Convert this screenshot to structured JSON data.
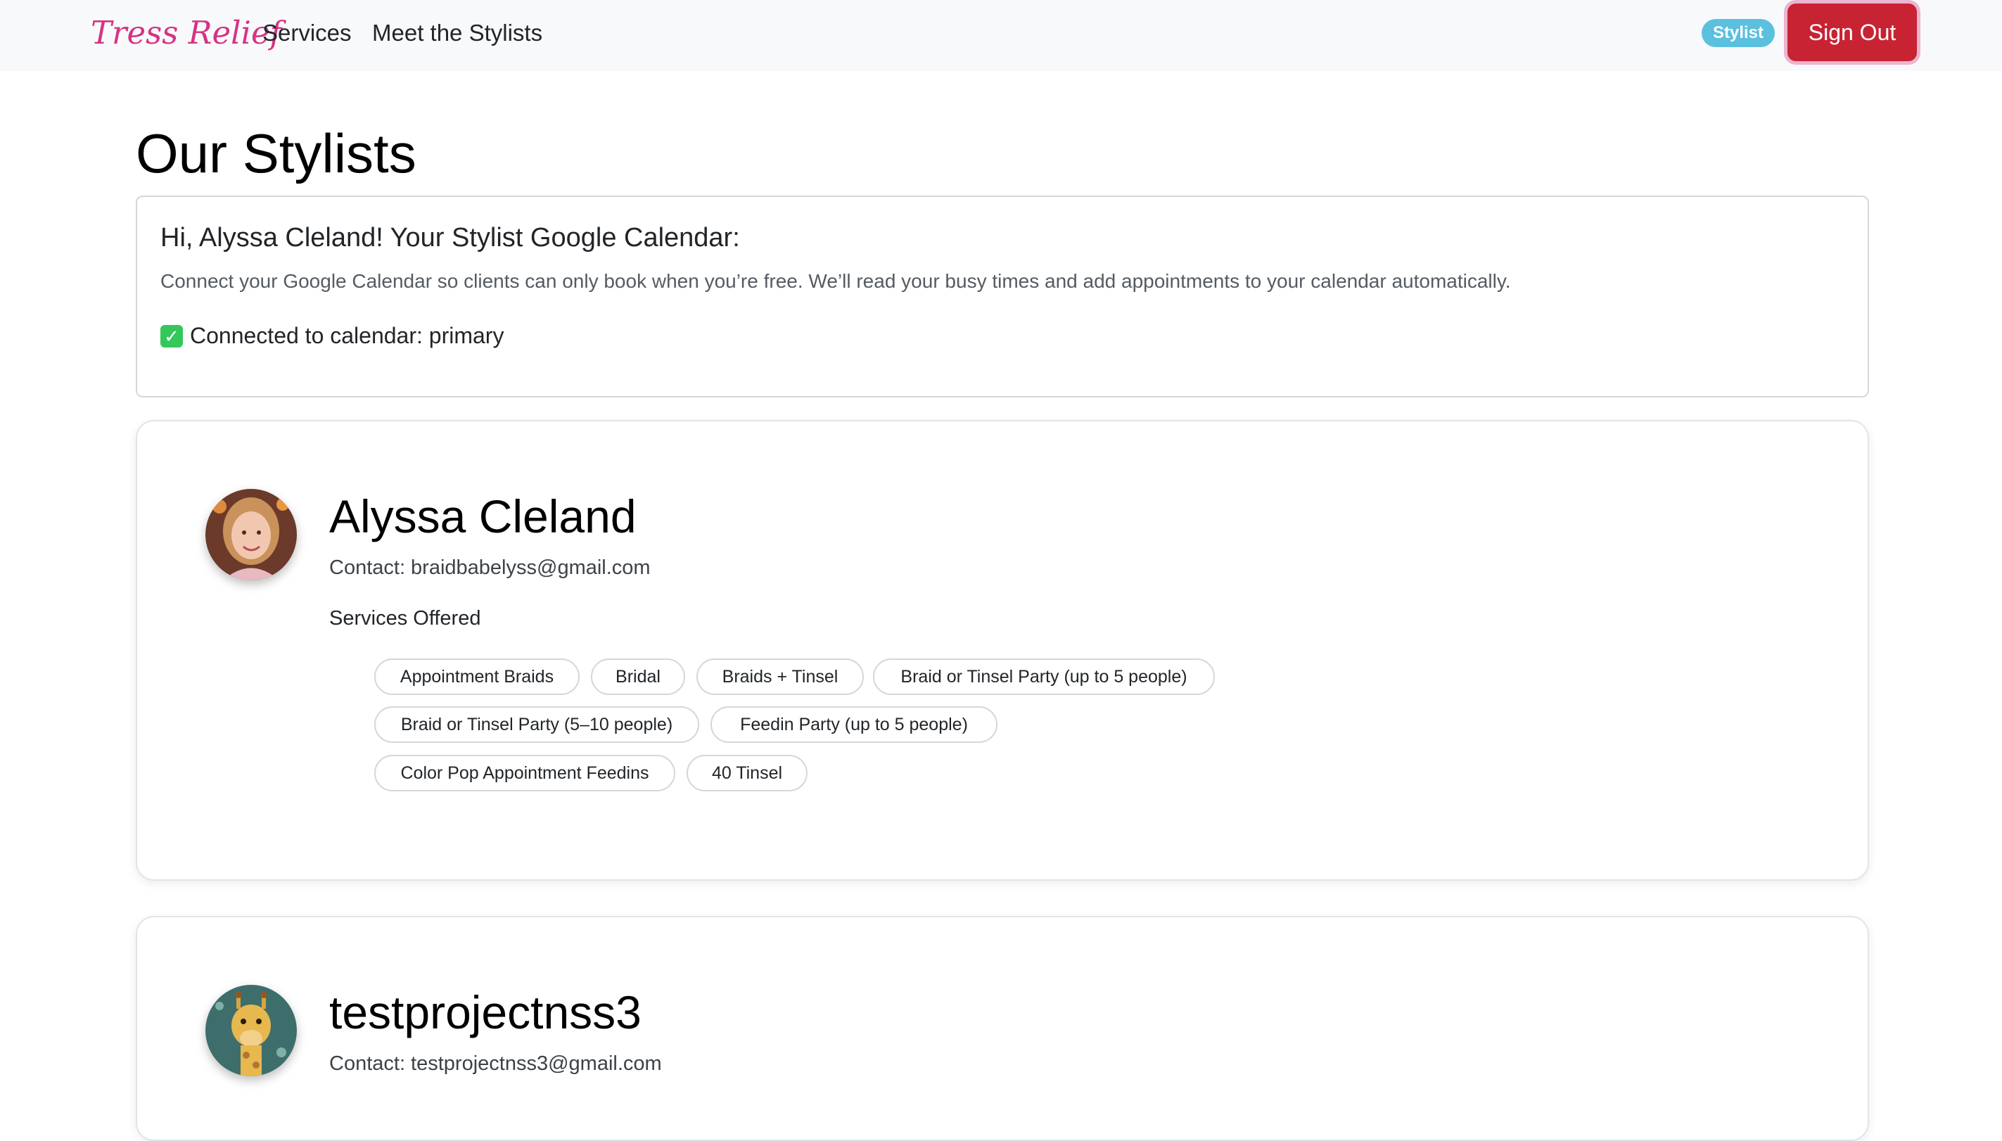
{
  "nav": {
    "brand": "Tress Relief",
    "links": [
      "Services",
      "Meet the Stylists"
    ],
    "role_badge": "Stylist",
    "sign_out": "Sign Out"
  },
  "page": {
    "title": "Our Stylists"
  },
  "calendar_card": {
    "heading": "Hi, Alyssa Cleland! Your Stylist Google Calendar:",
    "description": "Connect your Google Calendar so clients can only book when you’re free. We’ll read your busy times and add appointments to your calendar automatically.",
    "status_icon": "check-mark-icon",
    "status": "Connected to calendar: primary"
  },
  "stylists": [
    {
      "name": "Alyssa Cleland",
      "contact": "Contact: braidbabelyss@gmail.com",
      "services_heading": "Services Offered",
      "services": [
        "Appointment Braids",
        "Bridal",
        "Braids + Tinsel",
        "Braid or Tinsel Party (up to 5 people)",
        "Braid or Tinsel Party (5–10 people)",
        "Feedin Party (up to 5 people)",
        "Color Pop Appointment Feedins",
        "40 Tinsel"
      ]
    },
    {
      "name": "testprojectnss3",
      "contact": "Contact: testprojectnss3@gmail.com"
    }
  ],
  "colors": {
    "brand": "#d63384",
    "badge": "#5bc0de",
    "sign_out": "#c82333",
    "navbar_bg": "#f8f9fa"
  }
}
